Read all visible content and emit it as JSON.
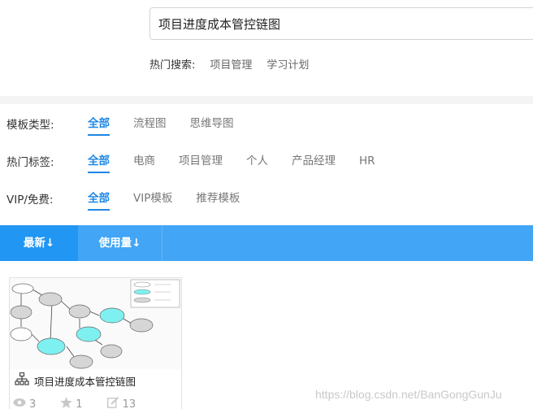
{
  "search": {
    "value": "项目进度成本管控链图",
    "hot_label": "热门搜索:",
    "hot_links": [
      "项目管理",
      "学习计划"
    ]
  },
  "filters": {
    "type": {
      "label": "模板类型:",
      "options": [
        "全部",
        "流程图",
        "思维导图"
      ],
      "selected": "全部"
    },
    "tags": {
      "label": "热门标签:",
      "options": [
        "全部",
        "电商",
        "项目管理",
        "个人",
        "产品经理",
        "HR"
      ],
      "selected": "全部"
    },
    "vip": {
      "label": "VIP/免费:",
      "options": [
        "全部",
        "VIP模板",
        "推荐模板"
      ],
      "selected": "全部"
    }
  },
  "sort": {
    "latest_label": "最新↓",
    "usage_label": "使用量↓"
  },
  "card": {
    "title": "项目进度成本管控链图",
    "views": "3",
    "stars": "1",
    "edits": "13",
    "icon": "flowchart-icon"
  },
  "watermark": "https://blog.csdn.net/BanGongGunJu",
  "colors": {
    "accent": "#1e88e5",
    "sort_bar": "#42a5f5",
    "sort_active": "#2196f3",
    "node_cyan": "#7ff0f0",
    "node_gray": "#d6d6d6"
  }
}
